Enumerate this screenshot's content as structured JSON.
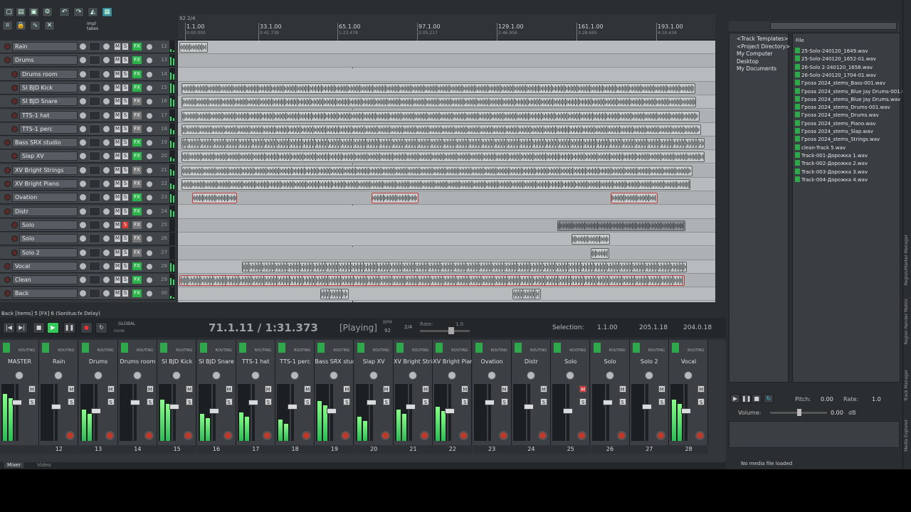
{
  "app": {
    "toolbar_icons": [
      "new-project",
      "open-project",
      "save-project",
      "project-settings",
      "undo",
      "redo",
      "metronome",
      "grid-snap",
      "ripple-edit",
      "lock",
      "envelopes",
      "auto-crossfade"
    ],
    "impl_takes_label": "impl\ntakes"
  },
  "ruler": {
    "top_left": "92 2/4",
    "marks": [
      {
        "bar": "1.1.00",
        "time": "0:00.000"
      },
      {
        "bar": "33.1.00",
        "time": "0:41.739"
      },
      {
        "bar": "65.1.00",
        "time": "1:23.478"
      },
      {
        "bar": "97.1.00",
        "time": "2:05.217"
      },
      {
        "bar": "129.1.00",
        "time": "2:46.956"
      },
      {
        "bar": "161.1.00",
        "time": "3:28.695"
      },
      {
        "bar": "193.1.00",
        "time": "4:10.434"
      }
    ]
  },
  "tracks": [
    {
      "name": "Rain",
      "num": "12",
      "indent": 0,
      "fx": true,
      "rec": false
    },
    {
      "name": "Drums",
      "num": "13",
      "indent": 0,
      "fx": true,
      "rec": false
    },
    {
      "name": "Drums room",
      "num": "14",
      "indent": 1,
      "fx": true,
      "rec": false
    },
    {
      "name": "SI BJD Kick",
      "num": "15",
      "indent": 1,
      "fx": true,
      "rec": false
    },
    {
      "name": "SI BJD Snare",
      "num": "16",
      "indent": 1,
      "fx": false,
      "rec": false
    },
    {
      "name": "TTS-1 hat",
      "num": "17",
      "indent": 1,
      "fx": false,
      "rec": false
    },
    {
      "name": "TTS-1 perc",
      "num": "18",
      "indent": 1,
      "fx": false,
      "rec": false
    },
    {
      "name": "Bass SRX studio",
      "num": "19",
      "indent": 0,
      "fx": true,
      "rec": false
    },
    {
      "name": "Slap XV",
      "num": "20",
      "indent": 1,
      "fx": true,
      "rec": false
    },
    {
      "name": "XV Bright Strings",
      "num": "21",
      "indent": 0,
      "fx": false,
      "rec": false
    },
    {
      "name": "XV Bright Piano",
      "num": "22",
      "indent": 0,
      "fx": false,
      "rec": false
    },
    {
      "name": "Ovation",
      "num": "23",
      "indent": 0,
      "fx": true,
      "rec": false
    },
    {
      "name": "Distr",
      "num": "24",
      "indent": 0,
      "fx": true,
      "rec": false
    },
    {
      "name": "Solo",
      "num": "25",
      "indent": 1,
      "fx": false,
      "rec": true
    },
    {
      "name": "Solo",
      "num": "26",
      "indent": 1,
      "fx": false,
      "rec": false
    },
    {
      "name": "Solo 2",
      "num": "27",
      "indent": 1,
      "fx": false,
      "rec": false
    },
    {
      "name": "Vocal",
      "num": "28",
      "indent": 0,
      "fx": true,
      "rec": false
    },
    {
      "name": "Clean",
      "num": "29",
      "indent": 0,
      "fx": true,
      "rec": false
    },
    {
      "name": "Back",
      "num": "30",
      "indent": 0,
      "fx": true,
      "rec": false
    }
  ],
  "status_line": "Back [items] 5 [FX] 6 (Sonitus:fx Delay)",
  "transport": {
    "position": "71.1.11 / 1:31.373",
    "state": "[Playing]",
    "bpm_label": "BPM",
    "bpm": "92",
    "time_sig": "2/4",
    "rate_label": "Rate:",
    "rate": "1.0",
    "global_label": "GLOBAL",
    "global_sub": "none",
    "selection_label": "Selection:",
    "sel_start": "1.1.00",
    "sel_end": "205.1.18",
    "sel_len": "204.0.18"
  },
  "mixer": {
    "strips": [
      {
        "name": "MASTER",
        "num": ""
      },
      {
        "name": "Rain",
        "num": "12"
      },
      {
        "name": "Drums",
        "num": "13"
      },
      {
        "name": "Drums room",
        "num": "14"
      },
      {
        "name": "SI BJD Kick",
        "num": "15"
      },
      {
        "name": "SI BJD Snare",
        "num": "16"
      },
      {
        "name": "TTS-1 hat",
        "num": "17"
      },
      {
        "name": "TTS-1 perc",
        "num": "18"
      },
      {
        "name": "Bass SRX stud",
        "num": "19"
      },
      {
        "name": "Slap XV",
        "num": "20"
      },
      {
        "name": "XV Bright Strir",
        "num": "21"
      },
      {
        "name": "XV Bright Piar",
        "num": "22"
      },
      {
        "name": "Ovation",
        "num": "23"
      },
      {
        "name": "Distr",
        "num": "24"
      },
      {
        "name": "Solo",
        "num": "25"
      },
      {
        "name": "Solo",
        "num": "26"
      },
      {
        "name": "Solo 2",
        "num": "27"
      },
      {
        "name": "Vocal",
        "num": "28"
      }
    ],
    "tab_mixer": "Mixer",
    "tab_video": "Video"
  },
  "media_explorer": {
    "tree": [
      "<Track Templates>",
      "<Project Directory>",
      "My Computer",
      "Desktop",
      "My Documents"
    ],
    "column": "File",
    "files": [
      "25-Solo-240120_1649.wav",
      "25-Solo-240120_1652-01.wav",
      "26-Solo 2-240120_1658.wav",
      "26-Solo-240120_1704-01.wav",
      "Гроза 2024_stems_Bass-001.wav",
      "Гроза 2024_stems_Blue Jay Drums-001.wa",
      "Гроза 2024_stems_Blue Jay Drums.wav",
      "Гроза 2024_stems_Drums-001.wav",
      "Гроза 2024_stems_Drums.wav",
      "Гроза 2024_stems_Piano.wav",
      "Гроза 2024_stems_Slap.wav",
      "Гроза 2024_stems_Strings.wav",
      "clean-Track 5.wav",
      "Track-001-Дорожка 1.wav",
      "Track-002-Дорожка 2.wav",
      "Track-003-Дорожка 3.wav",
      "Track-004-Дорожка 4.wav"
    ],
    "pitch_label": "Pitch:",
    "pitch": "0.00",
    "rate_label": "Rate:",
    "rate": "1.0",
    "volume_label": "Volume:",
    "volume": "0.00",
    "volume_unit": "dB",
    "status": "No media file loaded"
  },
  "side_tabs": [
    "Region/Marker Manager",
    "Region Render Matrix",
    "Track Manager",
    "Media Explorer"
  ],
  "colors": {
    "accent": "#2bb34a",
    "record": "#d33333",
    "background": "#2b2e31"
  }
}
